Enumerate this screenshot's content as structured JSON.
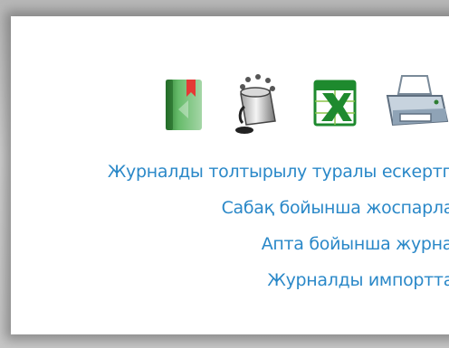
{
  "toolbar": {
    "icons": [
      {
        "name": "green-journal-book-icon"
      },
      {
        "name": "paint-bucket-icon"
      },
      {
        "name": "excel-export-icon"
      },
      {
        "name": "printer-icon"
      }
    ]
  },
  "links": [
    {
      "label": "Журналды толтырылу туралы ескертпе"
    },
    {
      "label": "Сабақ бойынша жоспарлау"
    },
    {
      "label": "Апта бойынша журнал"
    },
    {
      "label": "Журналды импорттау"
    }
  ],
  "colors": {
    "link": "#2a88c8",
    "excel_green": "#1e8a2e",
    "book_green": "#4caf50"
  }
}
